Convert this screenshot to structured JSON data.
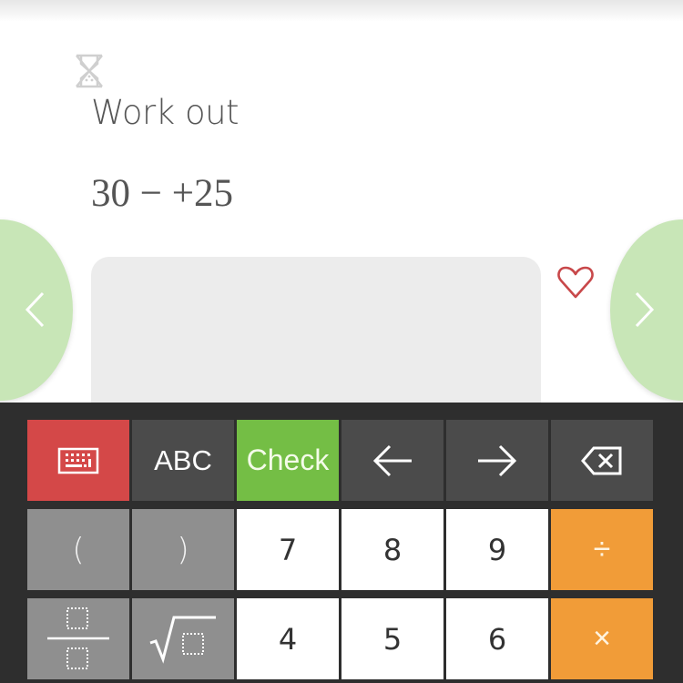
{
  "question": {
    "prompt": "Work out",
    "expression": "30 − +25",
    "timer_icon": "hourglass-crossed-icon",
    "favorite_icon": "heart-outline-icon"
  },
  "answer": {
    "value": ""
  },
  "navigation": {
    "prev_icon": "chevron-left-icon",
    "next_icon": "chevron-right-icon"
  },
  "keyboard": {
    "rows": [
      [
        {
          "id": "keyboard-toggle",
          "label": "",
          "icon": "keyboard-icon",
          "style": "red"
        },
        {
          "id": "abc",
          "label": "ABC",
          "style": "dark"
        },
        {
          "id": "check",
          "label": "Check",
          "style": "green"
        },
        {
          "id": "cursor-left",
          "label": "",
          "icon": "arrow-left-icon",
          "style": "dark"
        },
        {
          "id": "cursor-right",
          "label": "",
          "icon": "arrow-right-icon",
          "style": "dark"
        },
        {
          "id": "backspace",
          "label": "",
          "icon": "backspace-icon",
          "style": "dark"
        }
      ],
      [
        {
          "id": "open-paren",
          "label": "(",
          "style": "grey"
        },
        {
          "id": "close-paren",
          "label": ")",
          "style": "grey"
        },
        {
          "id": "digit-7",
          "label": "7",
          "style": "white"
        },
        {
          "id": "digit-8",
          "label": "8",
          "style": "white"
        },
        {
          "id": "digit-9",
          "label": "9",
          "style": "white"
        },
        {
          "id": "divide",
          "label": "÷",
          "style": "orange"
        }
      ],
      [
        {
          "id": "fraction",
          "label": "",
          "icon": "fraction-icon",
          "style": "grey"
        },
        {
          "id": "square-root",
          "label": "",
          "icon": "square-root-icon",
          "style": "grey"
        },
        {
          "id": "digit-4",
          "label": "4",
          "style": "white"
        },
        {
          "id": "digit-5",
          "label": "5",
          "style": "white"
        },
        {
          "id": "digit-6",
          "label": "6",
          "style": "white"
        },
        {
          "id": "multiply",
          "label": "×",
          "style": "orange"
        }
      ]
    ]
  },
  "colors": {
    "nav_green": "#c8e6b7",
    "check_green": "#74be45",
    "keyboard_red": "#d44848",
    "operator_orange": "#f19c38",
    "heart_red": "#c8484a"
  }
}
